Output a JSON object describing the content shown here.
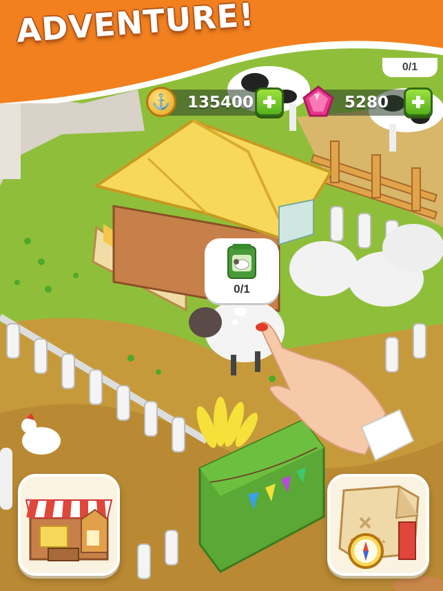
{
  "banner": {
    "title": "ADVENTURE!"
  },
  "hud": {
    "coins": "135400",
    "gems": "5280"
  },
  "hint": {
    "progress": "0/1"
  },
  "top_counter": {
    "progress": "0/1"
  },
  "colors": {
    "banner_orange": "#f2801e",
    "grass": "#8fbf3a",
    "plus_green": "#54b01c",
    "gem_pink": "#e8358a"
  },
  "icons": {
    "coin": "anchor-coin-icon",
    "gem": "pink-gem-icon",
    "market": "market-stall-icon",
    "map": "treasure-map-icon"
  }
}
